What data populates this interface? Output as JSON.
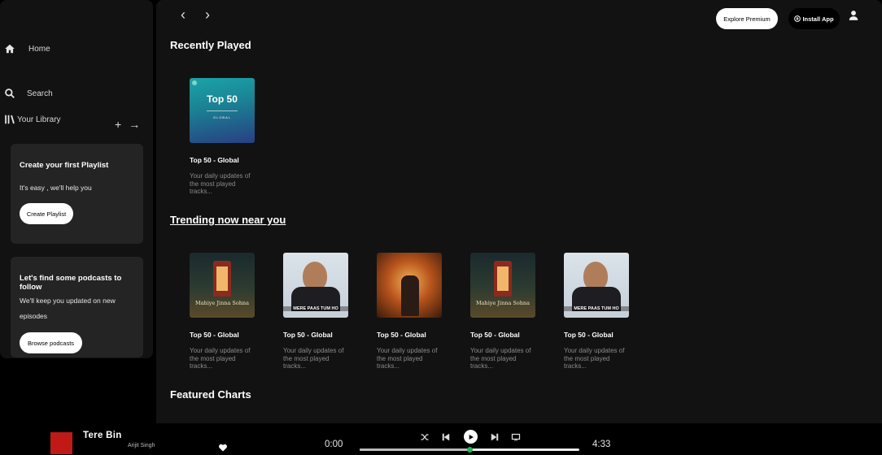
{
  "sidebar": {
    "home_label": "Home",
    "search_label": "Search",
    "library_label": "Your Library",
    "add_symbol": "+",
    "expand_symbol": "→",
    "playlist_card": {
      "title": "Create your first Playlist",
      "text": "It's easy , we'll help you",
      "button": "Create Playlist"
    },
    "podcast_card": {
      "title": "Let's find some podcasts to follow",
      "text": "We'll keep you updated on new episodes",
      "button": "Browse podcasts"
    }
  },
  "header": {
    "back_symbol": "‹",
    "forward_symbol": "›",
    "premium_button": "Explore Premium",
    "install_button": "Install App"
  },
  "recently_played": {
    "title": "Recently Played",
    "items": [
      {
        "art_main": "Top 50",
        "art_sub": "GLOBAL",
        "title": "Top 50 - Global",
        "desc": "Your daily updates of the most played tracks..."
      }
    ]
  },
  "trending": {
    "title": "Trending now near you",
    "items": [
      {
        "art": "booth",
        "art_caption": "Mahiye Jinna Sohna",
        "title": "Top 50 - Global",
        "desc": "Your daily updates of the most played tracks..."
      },
      {
        "art": "singer",
        "art_caption": "MERE PAAS TUM HO",
        "title": "Top 50 - Global",
        "desc": "Your daily updates of the most played tracks..."
      },
      {
        "art": "fire",
        "art_caption": "",
        "title": "Top 50 - Global",
        "desc": "Your daily updates of the most played tracks..."
      },
      {
        "art": "booth",
        "art_caption": "Mahiye Jinna Sohna",
        "title": "Top 50 - Global",
        "desc": "Your daily updates of the most played tracks..."
      },
      {
        "art": "singer",
        "art_caption": "MERE PAAS TUM HO",
        "title": "Top 50 - Global",
        "desc": "Your daily updates of the most played tracks..."
      }
    ]
  },
  "featured": {
    "title": "Featured Charts"
  },
  "player": {
    "track_title": "Tere Bin",
    "artist": "Arijit Singh",
    "current_time": "0:00",
    "total_time": "4:33",
    "progress_fraction": 0.5
  }
}
